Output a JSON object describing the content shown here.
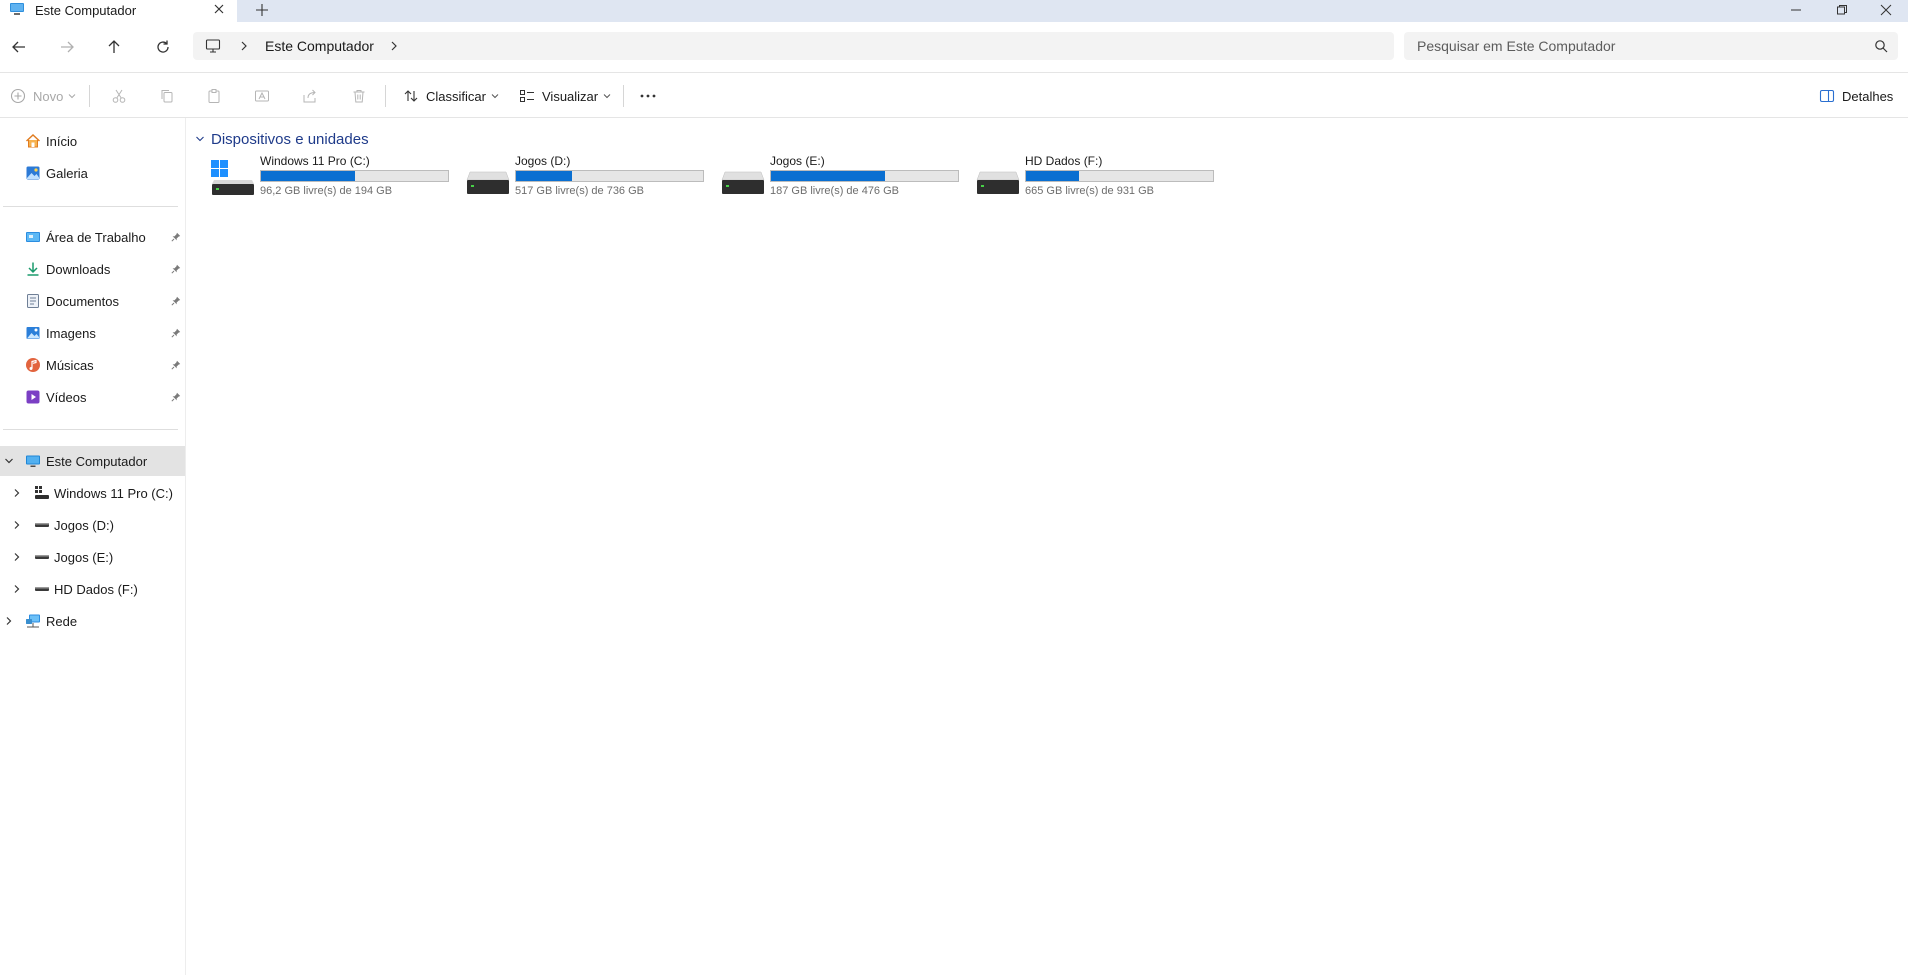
{
  "window": {
    "tab_title": "Este Computador",
    "tab_close_icon": "close-icon",
    "new_tab_icon": "plus-icon",
    "controls": [
      "minimize-icon",
      "restore-icon",
      "close-icon"
    ]
  },
  "nav": {
    "back_icon": "arrow-left-icon",
    "forward_icon": "arrow-right-icon",
    "up_icon": "arrow-up-icon",
    "refresh_icon": "refresh-icon",
    "breadcrumb": [
      "Este Computador"
    ],
    "search_placeholder": "Pesquisar em Este Computador"
  },
  "toolbar": {
    "new_label": "Novo",
    "sort_label": "Classificar",
    "view_label": "Visualizar",
    "more_label": "...",
    "details_label": "Detalhes",
    "disabled_actions": [
      "cut-icon",
      "copy-icon",
      "paste-icon",
      "rename-icon",
      "share-icon",
      "delete-icon"
    ]
  },
  "sidebar": {
    "top": [
      {
        "label": "Início",
        "icon": "home-icon"
      },
      {
        "label": "Galeria",
        "icon": "gallery-icon"
      }
    ],
    "pinned": [
      {
        "label": "Área de Trabalho",
        "icon": "desktop-folder-icon"
      },
      {
        "label": "Downloads",
        "icon": "download-icon"
      },
      {
        "label": "Documentos",
        "icon": "document-icon"
      },
      {
        "label": "Imagens",
        "icon": "pictures-icon"
      },
      {
        "label": "Músicas",
        "icon": "music-icon"
      },
      {
        "label": "Vídeos",
        "icon": "videos-icon"
      }
    ],
    "tree": {
      "root": {
        "label": "Este Computador",
        "icon": "computer-icon",
        "expanded": true,
        "selected": true
      },
      "children": [
        {
          "label": "Windows 11 Pro (C:)",
          "icon": "windows-drive-icon"
        },
        {
          "label": "Jogos (D:)",
          "icon": "drive-icon"
        },
        {
          "label": "Jogos (E:)",
          "icon": "drive-icon"
        },
        {
          "label": "HD Dados (F:)",
          "icon": "drive-icon"
        }
      ],
      "network": {
        "label": "Rede",
        "icon": "network-icon"
      }
    }
  },
  "content": {
    "group_title": "Dispositivos e unidades",
    "drives": [
      {
        "name": "Windows 11 Pro (C:)",
        "free_text": "96,2 GB livre(s) de 194 GB",
        "used_fraction": 0.504,
        "icon": "windows-drive-icon"
      },
      {
        "name": "Jogos (D:)",
        "free_text": "517 GB livre(s) de 736 GB",
        "used_fraction": 0.298,
        "icon": "drive-icon"
      },
      {
        "name": "Jogos (E:)",
        "free_text": "187 GB livre(s) de 476 GB",
        "used_fraction": 0.607,
        "icon": "drive-icon"
      },
      {
        "name": "HD Dados (F:)",
        "free_text": "665 GB livre(s) de 931 GB",
        "used_fraction": 0.286,
        "icon": "drive-icon"
      }
    ]
  },
  "colors": {
    "accent": "#0a6fd1",
    "header_text": "#1f3b8a",
    "selection": "#e3e3e3"
  }
}
